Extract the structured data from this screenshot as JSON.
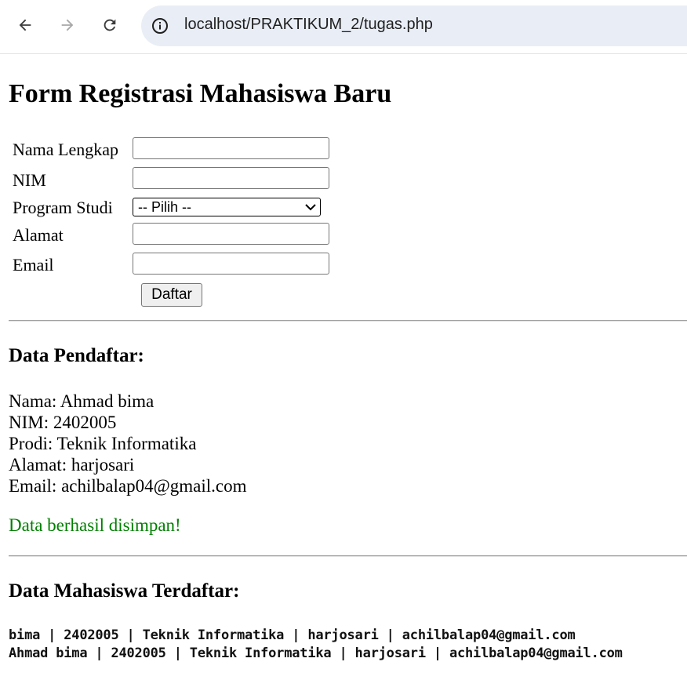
{
  "browser": {
    "url": "localhost/PRAKTIKUM_2/tugas.php",
    "icons": [
      "back-arrow-icon",
      "forward-arrow-icon",
      "reload-icon",
      "site-info-icon"
    ]
  },
  "form": {
    "title": "Form Registrasi Mahasiswa Baru",
    "fields": {
      "nama_label": "Nama Lengkap",
      "nim_label": "NIM",
      "prodi_label": "Program Studi",
      "prodi_selected": "-- Pilih --",
      "alamat_label": "Alamat",
      "email_label": "Email",
      "nama_value": "",
      "nim_value": "",
      "alamat_value": "",
      "email_value": ""
    },
    "submit_label": "Daftar"
  },
  "pendaftar": {
    "heading": "Data Pendaftar:",
    "lines": [
      "Nama: Ahmad bima",
      "NIM: 2402005",
      "Prodi: Teknik Informatika",
      "Alamat: harjosari",
      "Email: achilbalap04@gmail.com"
    ],
    "success": "Data berhasil disimpan!"
  },
  "terdaftar": {
    "heading": "Data Mahasiswa Terdaftar:",
    "rows": [
      "bima | 2402005 | Teknik Informatika | harjosari | achilbalap04@gmail.com",
      "Ahmad bima | 2402005 | Teknik Informatika | harjosari | achilbalap04@gmail.com"
    ]
  },
  "colors": {
    "success": "#008000",
    "address_bar": "#e9eef6"
  }
}
